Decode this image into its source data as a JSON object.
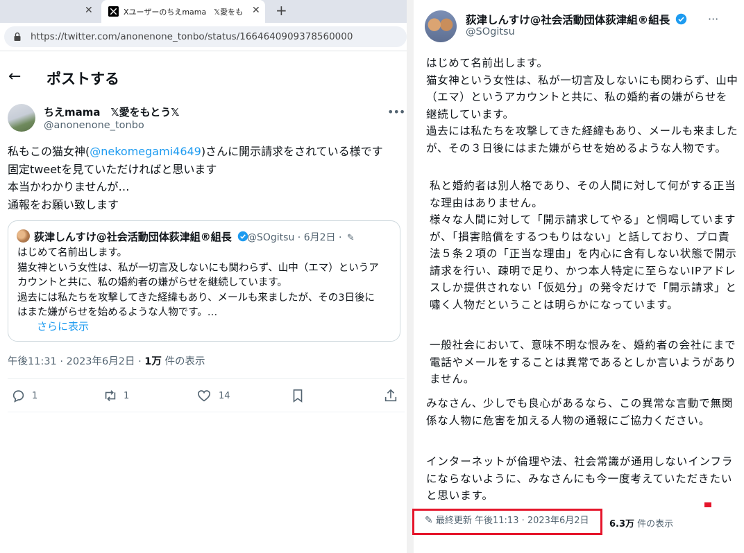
{
  "browser": {
    "tabs": [
      {
        "label": ""
      },
      {
        "label": "Xユーザーのちえmama　𝕏愛をもとう"
      }
    ],
    "url": "https://twitter.com/anonenone_tonbo/status/1664640909378560000"
  },
  "left_tweet": {
    "header_title": "ポストする",
    "author_name": "ちえmama　𝕏愛をもとう𝕏",
    "author_handle": "@anonenone_tonbo",
    "body": {
      "line1_pre": "私もこの猫女神(",
      "mention": "@nekomegami4649",
      "line1_post": ")さんに開示請求をされている様です",
      "line2": "固定tweetを見ていただければと思います",
      "line3": "本当かわかりませんが…",
      "line4": "通報をお願い致します"
    },
    "quote": {
      "name": "荻津しんすけ@社会活動団体荻津組®組長",
      "meta": "@SOgitsu · 6月2日 ·",
      "lines": [
        "はじめて名前出します。",
        "猫女神という女性は、私が一切言及しないにも関わらず、山中（エマ）というア",
        "カウントと共に、私の婚約者の嫌がらせを継続しています。",
        "過去には私たちを攻撃してきた経緯もあり、メールも来ましたが、その3日後に",
        "はまた嫌がらせを始めるような人物です。…"
      ],
      "show_more": "さらに表示"
    },
    "timestamp_pre": "午後11:31 · 2023年6月2日 · ",
    "views_count": "1万",
    "views_label": " 件の表示",
    "actions": {
      "reply_count": "1",
      "retweet_count": "1",
      "like_count": "14"
    }
  },
  "right_tweet": {
    "author_name": "荻津しんすけ@社会活動団体荻津組®組長",
    "author_handle": "@SOgitsu",
    "paragraphs": {
      "p1": "はじめて名前出します。\n猫女神という女性は、私が一切言及しないにも関わらず、山中（エマ）というアカウントと共に、私の婚約者の嫌がらせを継続しています。\n過去には私たちを攻撃してきた経緯もあり、メールも来ましたが、その３日後にはまた嫌がらせを始めるような人物です。",
      "p2": "私と婚約者は別人格であり、その人間に対して何がする正当な理由はありません。\n様々な人間に対して「開示請求してやる」と恫喝していますが、「損害賠償をするつもりはない」と話しており、プロ責法５条２項の「正当な理由」を内心に含有しない状態で開示請求を行い、疎明で足り、かつ本人特定に至らないIPアドレスしか提供されない「仮処分」の発令だけで「開示請求」と嘯く人物だということは明らかになっています。",
      "p3": "一般社会において、意味不明な恨みを、婚約者の会社にまで電話やメールをすることは異常であるとしか言いようがありません。",
      "p4": "みなさん、少しでも良心があるなら、この異常な言動で無関係な人物に危害を加える人物の通報にご協力ください。",
      "p5": "インターネットが倫理や法、社会常識が通用しないインフラにならないように、みなさんにも今一度考えていただきたいと思います。"
    },
    "last_updated": "最終更新 午後11:13 · 2023年6月2日",
    "views_count": "6.3万",
    "views_label": " 件の表示"
  },
  "colors": {
    "link": "#1d9bf0",
    "secondary_text": "#536471",
    "highlight": "#e5152b",
    "verified": "#1d9bf0"
  },
  "icons": [
    "close-icon",
    "x-logo-icon",
    "plus-icon",
    "site-info-icon",
    "back-arrow-icon",
    "more-icon",
    "verified-badge-icon",
    "edit-pencil-icon",
    "reply-icon",
    "retweet-icon",
    "like-icon",
    "bookmark-icon",
    "share-icon"
  ]
}
